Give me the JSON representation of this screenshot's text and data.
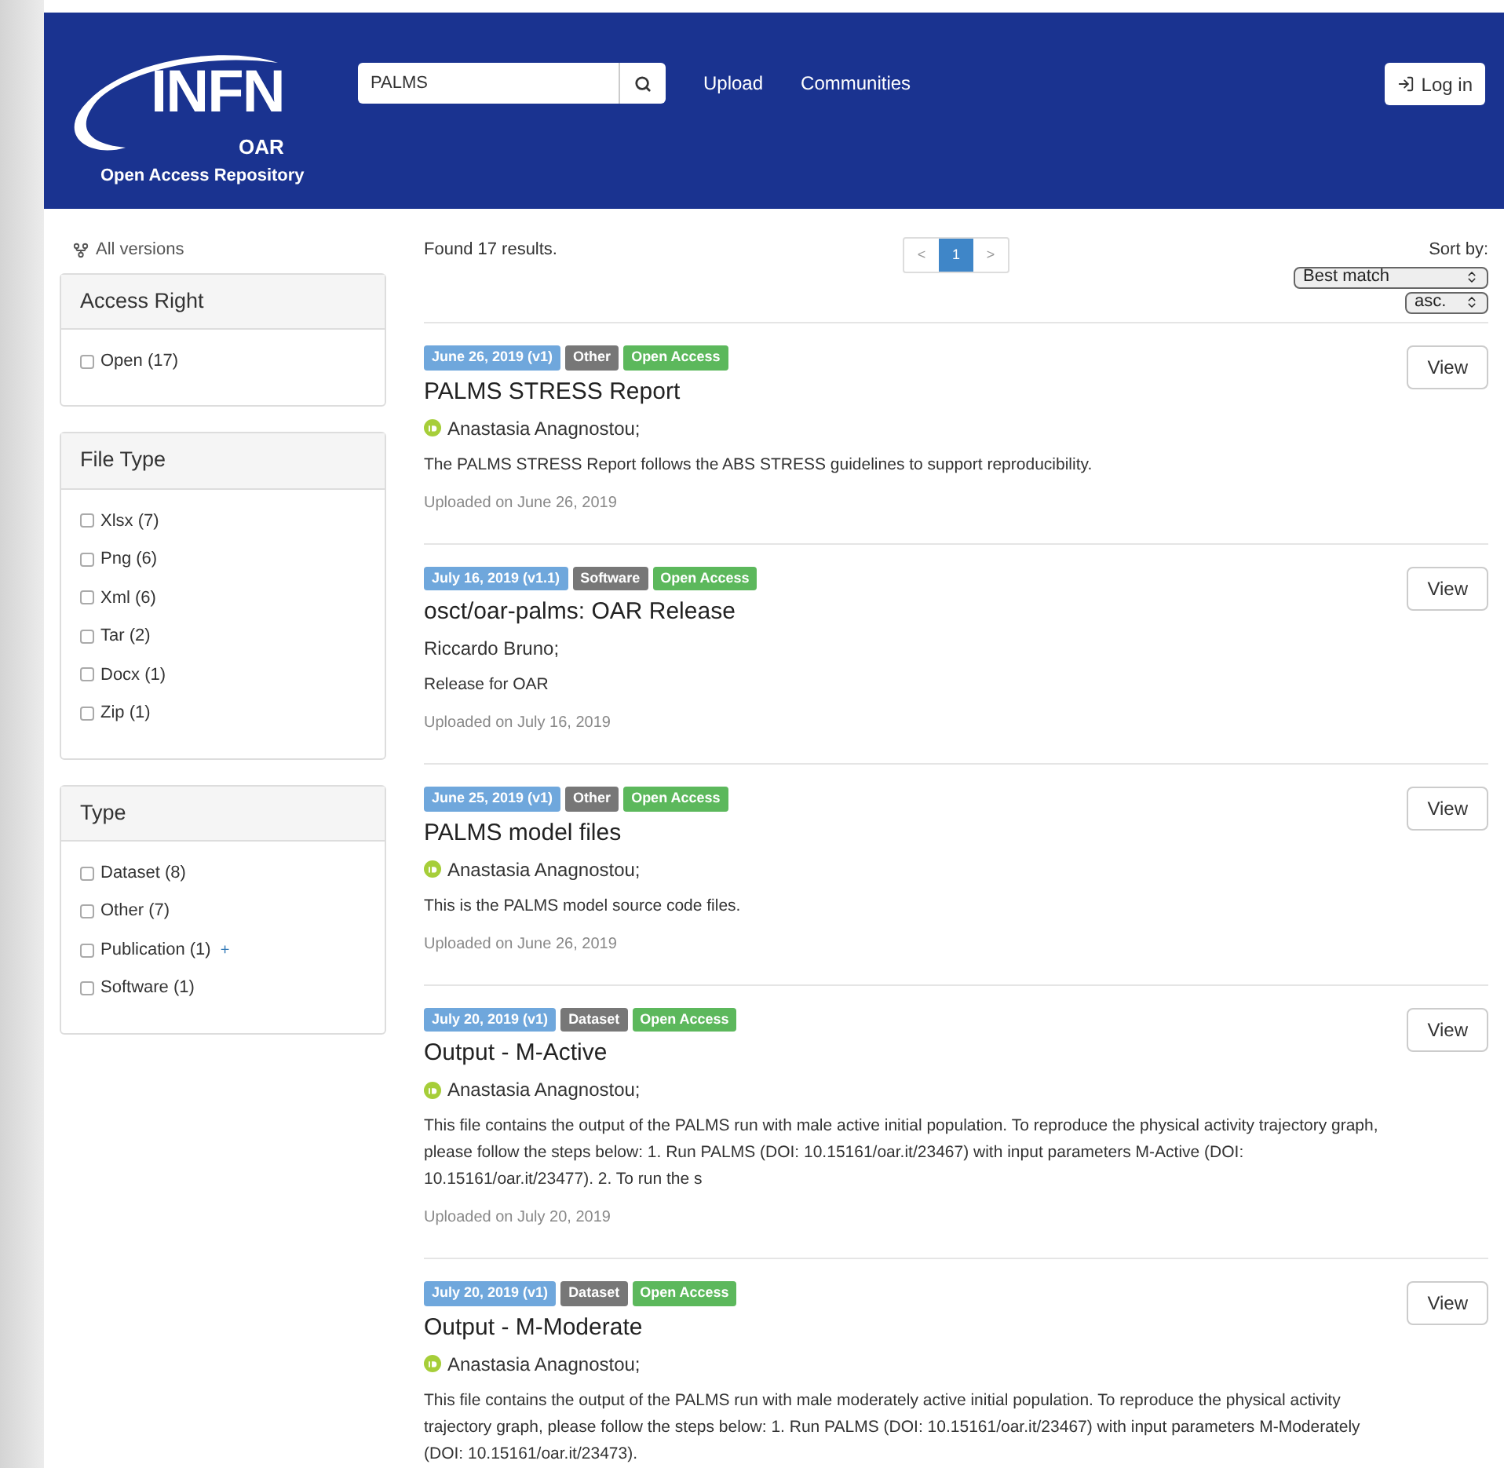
{
  "header": {
    "logo": {
      "word": "INFN",
      "sub": "OAR",
      "tagline": "Open Access Repository"
    },
    "search": {
      "value": "PALMS"
    },
    "nav": [
      "Upload",
      "Communities"
    ],
    "login": "Log in"
  },
  "sidebar": {
    "versions_link": "All versions",
    "facets": [
      {
        "title": "Access Right",
        "options": [
          {
            "label": "Open (17)",
            "checked": false
          }
        ]
      },
      {
        "title": "File Type",
        "options": [
          {
            "label": "Xlsx (7)",
            "checked": false
          },
          {
            "label": "Png (6)",
            "checked": false
          },
          {
            "label": "Xml (6)",
            "checked": false
          },
          {
            "label": "Tar (2)",
            "checked": false
          },
          {
            "label": "Docx (1)",
            "checked": false
          },
          {
            "label": "Zip (1)",
            "checked": false
          }
        ]
      },
      {
        "title": "Type",
        "options": [
          {
            "label": "Dataset (8)",
            "checked": false
          },
          {
            "label": "Other (7)",
            "checked": false
          },
          {
            "label": "Publication (1)",
            "checked": false,
            "expand_mark": "+"
          },
          {
            "label": "Software (1)",
            "checked": false
          }
        ]
      }
    ]
  },
  "results_summary": "Found 17 results.",
  "pagination": {
    "prev": "<",
    "next": ">",
    "pages": [
      {
        "label": "1",
        "selected": true
      }
    ]
  },
  "sort": {
    "label": "Sort by:",
    "field": "Best match",
    "order": "asc."
  },
  "results": [
    {
      "badges": [
        {
          "kind": "date",
          "text": "June 26, 2019 (v1)"
        },
        {
          "kind": "type",
          "text": "Other"
        },
        {
          "kind": "access",
          "text": "Open Access"
        }
      ],
      "title": "PALMS STRESS Report",
      "authors": "Anastasia Anagnostou;",
      "orcid": true,
      "description": "The PALMS STRESS Report follows the ABS STRESS guidelines to support reproducibility.",
      "uploaded": "Uploaded on June 26, 2019",
      "view": "View"
    },
    {
      "badges": [
        {
          "kind": "date",
          "text": "July 16, 2019 (v1.1)"
        },
        {
          "kind": "type",
          "text": "Software"
        },
        {
          "kind": "access",
          "text": "Open Access"
        }
      ],
      "title": "osct/oar-palms: OAR Release",
      "authors": "Riccardo Bruno;",
      "orcid": false,
      "description": "Release for OAR",
      "uploaded": "Uploaded on July 16, 2019",
      "view": "View"
    },
    {
      "badges": [
        {
          "kind": "date",
          "text": "June 25, 2019 (v1)"
        },
        {
          "kind": "type",
          "text": "Other"
        },
        {
          "kind": "access",
          "text": "Open Access"
        }
      ],
      "title": "PALMS model files",
      "authors": "Anastasia Anagnostou;",
      "orcid": true,
      "description": "This is the PALMS model source code files.",
      "uploaded": "Uploaded on June 26, 2019",
      "view": "View"
    },
    {
      "badges": [
        {
          "kind": "date",
          "text": "July 20, 2019 (v1)"
        },
        {
          "kind": "type",
          "text": "Dataset"
        },
        {
          "kind": "access",
          "text": "Open Access"
        }
      ],
      "title": "Output - M-Active",
      "authors": "Anastasia Anagnostou;",
      "orcid": true,
      "description": "This file contains the output of the PALMS run with male active initial population.  To reproduce the physical activity trajectory graph, please follow the steps below: 1. Run PALMS (DOI: 10.15161/oar.it/23467) with input parameters M-Active (DOI: 10.15161/oar.it/23477). 2. To run the s",
      "uploaded": "Uploaded on July 20, 2019",
      "view": "View"
    },
    {
      "badges": [
        {
          "kind": "date",
          "text": "July 20, 2019 (v1)"
        },
        {
          "kind": "type",
          "text": "Dataset"
        },
        {
          "kind": "access",
          "text": "Open Access"
        }
      ],
      "title": "Output - M-Moderate",
      "authors": "Anastasia Anagnostou;",
      "orcid": true,
      "description": "This file contains the output of the PALMS run with male moderately active initial population.  To reproduce the physical activity trajectory graph, please follow the steps below: 1. Run PALMS (DOI: 10.15161/oar.it/23467) with input parameters M-Moderately (DOI: 10.15161/oar.it/23473).",
      "view": "View"
    }
  ]
}
